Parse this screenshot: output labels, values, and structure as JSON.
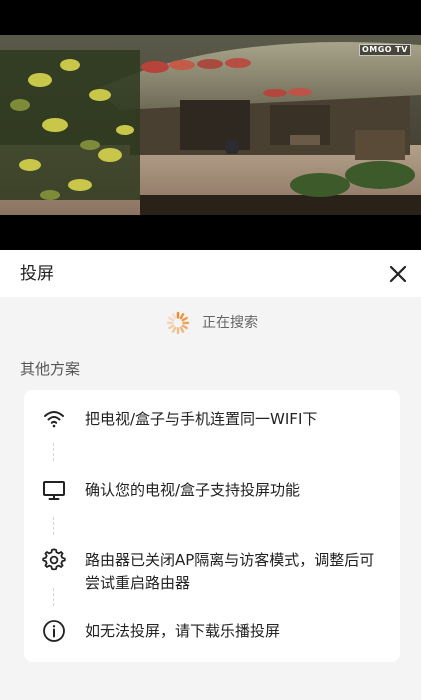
{
  "video": {
    "watermark": "OMGO TV"
  },
  "sheet": {
    "title": "投屏",
    "close_icon": "close-icon",
    "searching_text": "正在搜索",
    "other_heading": "其他方案",
    "steps": [
      {
        "icon": "wifi-icon",
        "text": "把电视/盒子与手机连置同一WIFI下"
      },
      {
        "icon": "monitor-icon",
        "text": "确认您的电视/盒子支持投屏功能"
      },
      {
        "icon": "gear-icon",
        "text": "路由器已关闭AP隔离与访客模式，调整后可尝试重启路由器"
      },
      {
        "icon": "info-icon",
        "text": "如无法投屏，请下载乐播投屏"
      }
    ]
  },
  "colors": {
    "spinner": "#f08a2c",
    "background": "#f4f4f4",
    "card": "#ffffff"
  }
}
